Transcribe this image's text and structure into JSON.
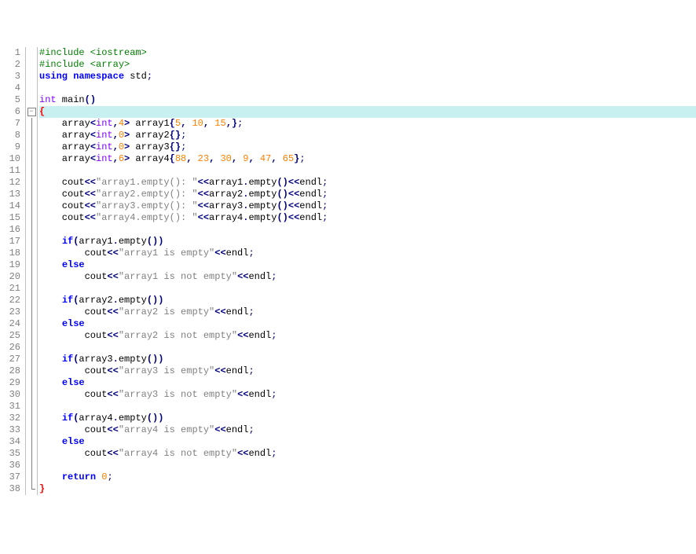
{
  "lines": [
    {
      "n": 1,
      "fold": "",
      "hl": false,
      "tokens": [
        [
          "pre",
          "#include <iostream>"
        ]
      ]
    },
    {
      "n": 2,
      "fold": "",
      "hl": false,
      "tokens": [
        [
          "pre",
          "#include <array>"
        ]
      ]
    },
    {
      "n": 3,
      "fold": "",
      "hl": false,
      "tokens": [
        [
          "kw",
          "using namespace"
        ],
        [
          "",
          " std"
        ],
        [
          "pn",
          ";"
        ]
      ]
    },
    {
      "n": 4,
      "fold": "",
      "hl": false,
      "tokens": [
        [
          "",
          ""
        ]
      ]
    },
    {
      "n": 5,
      "fold": "",
      "hl": false,
      "tokens": [
        [
          "kw2",
          "int"
        ],
        [
          "",
          " main"
        ],
        [
          "op",
          "()"
        ]
      ]
    },
    {
      "n": 6,
      "fold": "box",
      "hl": true,
      "tokens": [
        [
          "brace-r",
          "{"
        ]
      ]
    },
    {
      "n": 7,
      "fold": "vert",
      "hl": false,
      "tokens": [
        [
          "",
          "    array"
        ],
        [
          "op",
          "<"
        ],
        [
          "kw2",
          "int"
        ],
        [
          "op",
          ","
        ],
        [
          "num",
          "4"
        ],
        [
          "op",
          ">"
        ],
        [
          "",
          " array1"
        ],
        [
          "op",
          "{"
        ],
        [
          "num",
          "5"
        ],
        [
          "op",
          ", "
        ],
        [
          "num",
          "10"
        ],
        [
          "op",
          ", "
        ],
        [
          "num",
          "15"
        ],
        [
          "op",
          ",}"
        ],
        [
          "pn",
          ";"
        ]
      ]
    },
    {
      "n": 8,
      "fold": "vert",
      "hl": false,
      "tokens": [
        [
          "",
          "    array"
        ],
        [
          "op",
          "<"
        ],
        [
          "kw2",
          "int"
        ],
        [
          "op",
          ","
        ],
        [
          "num",
          "0"
        ],
        [
          "op",
          ">"
        ],
        [
          "",
          " array2"
        ],
        [
          "op",
          "{}"
        ],
        [
          "pn",
          ";"
        ]
      ]
    },
    {
      "n": 9,
      "fold": "vert",
      "hl": false,
      "tokens": [
        [
          "",
          "    array"
        ],
        [
          "op",
          "<"
        ],
        [
          "kw2",
          "int"
        ],
        [
          "op",
          ","
        ],
        [
          "num",
          "0"
        ],
        [
          "op",
          ">"
        ],
        [
          "",
          " array3"
        ],
        [
          "op",
          "{}"
        ],
        [
          "pn",
          ";"
        ]
      ]
    },
    {
      "n": 10,
      "fold": "vert",
      "hl": false,
      "tokens": [
        [
          "",
          "    array"
        ],
        [
          "op",
          "<"
        ],
        [
          "kw2",
          "int"
        ],
        [
          "op",
          ","
        ],
        [
          "num",
          "6"
        ],
        [
          "op",
          ">"
        ],
        [
          "",
          " array4"
        ],
        [
          "op",
          "{"
        ],
        [
          "num",
          "88"
        ],
        [
          "op",
          ", "
        ],
        [
          "num",
          "23"
        ],
        [
          "op",
          ", "
        ],
        [
          "num",
          "30"
        ],
        [
          "op",
          ", "
        ],
        [
          "num",
          "9"
        ],
        [
          "op",
          ", "
        ],
        [
          "num",
          "47"
        ],
        [
          "op",
          ", "
        ],
        [
          "num",
          "65"
        ],
        [
          "op",
          "}"
        ],
        [
          "pn",
          ";"
        ]
      ]
    },
    {
      "n": 11,
      "fold": "vert",
      "hl": false,
      "tokens": [
        [
          "",
          ""
        ]
      ]
    },
    {
      "n": 12,
      "fold": "vert",
      "hl": false,
      "tokens": [
        [
          "",
          "    cout"
        ],
        [
          "op",
          "<<"
        ],
        [
          "str",
          "\"array1.empty(): \""
        ],
        [
          "op",
          "<<"
        ],
        [
          "",
          "array1"
        ],
        [
          "op",
          "."
        ],
        [
          "",
          "empty"
        ],
        [
          "op",
          "()<<"
        ],
        [
          "",
          "endl"
        ],
        [
          "pn",
          ";"
        ]
      ]
    },
    {
      "n": 13,
      "fold": "vert",
      "hl": false,
      "tokens": [
        [
          "",
          "    cout"
        ],
        [
          "op",
          "<<"
        ],
        [
          "str",
          "\"array2.empty(): \""
        ],
        [
          "op",
          "<<"
        ],
        [
          "",
          "array2"
        ],
        [
          "op",
          "."
        ],
        [
          "",
          "empty"
        ],
        [
          "op",
          "()<<"
        ],
        [
          "",
          "endl"
        ],
        [
          "pn",
          ";"
        ]
      ]
    },
    {
      "n": 14,
      "fold": "vert",
      "hl": false,
      "tokens": [
        [
          "",
          "    cout"
        ],
        [
          "op",
          "<<"
        ],
        [
          "str",
          "\"array3.empty(): \""
        ],
        [
          "op",
          "<<"
        ],
        [
          "",
          "array3"
        ],
        [
          "op",
          "."
        ],
        [
          "",
          "empty"
        ],
        [
          "op",
          "()<<"
        ],
        [
          "",
          "endl"
        ],
        [
          "pn",
          ";"
        ]
      ]
    },
    {
      "n": 15,
      "fold": "vert",
      "hl": false,
      "tokens": [
        [
          "",
          "    cout"
        ],
        [
          "op",
          "<<"
        ],
        [
          "str",
          "\"array4.empty(): \""
        ],
        [
          "op",
          "<<"
        ],
        [
          "",
          "array4"
        ],
        [
          "op",
          "."
        ],
        [
          "",
          "empty"
        ],
        [
          "op",
          "()<<"
        ],
        [
          "",
          "endl"
        ],
        [
          "pn",
          ";"
        ]
      ]
    },
    {
      "n": 16,
      "fold": "vert",
      "hl": false,
      "tokens": [
        [
          "",
          ""
        ]
      ]
    },
    {
      "n": 17,
      "fold": "vert",
      "hl": false,
      "tokens": [
        [
          "",
          "    "
        ],
        [
          "kw",
          "if"
        ],
        [
          "op",
          "("
        ],
        [
          "",
          "array1"
        ],
        [
          "op",
          "."
        ],
        [
          "",
          "empty"
        ],
        [
          "op",
          "())"
        ]
      ]
    },
    {
      "n": 18,
      "fold": "vert",
      "hl": false,
      "tokens": [
        [
          "",
          "        cout"
        ],
        [
          "op",
          "<<"
        ],
        [
          "str",
          "\"array1 is empty\""
        ],
        [
          "op",
          "<<"
        ],
        [
          "",
          "endl"
        ],
        [
          "pn",
          ";"
        ]
      ]
    },
    {
      "n": 19,
      "fold": "vert",
      "hl": false,
      "tokens": [
        [
          "",
          "    "
        ],
        [
          "kw",
          "else"
        ]
      ]
    },
    {
      "n": 20,
      "fold": "vert",
      "hl": false,
      "tokens": [
        [
          "",
          "        cout"
        ],
        [
          "op",
          "<<"
        ],
        [
          "str",
          "\"array1 is not empty\""
        ],
        [
          "op",
          "<<"
        ],
        [
          "",
          "endl"
        ],
        [
          "pn",
          ";"
        ]
      ]
    },
    {
      "n": 21,
      "fold": "vert",
      "hl": false,
      "tokens": [
        [
          "",
          ""
        ]
      ]
    },
    {
      "n": 22,
      "fold": "vert",
      "hl": false,
      "tokens": [
        [
          "",
          "    "
        ],
        [
          "kw",
          "if"
        ],
        [
          "op",
          "("
        ],
        [
          "",
          "array2"
        ],
        [
          "op",
          "."
        ],
        [
          "",
          "empty"
        ],
        [
          "op",
          "())"
        ]
      ]
    },
    {
      "n": 23,
      "fold": "vert",
      "hl": false,
      "tokens": [
        [
          "",
          "        cout"
        ],
        [
          "op",
          "<<"
        ],
        [
          "str",
          "\"array2 is empty\""
        ],
        [
          "op",
          "<<"
        ],
        [
          "",
          "endl"
        ],
        [
          "pn",
          ";"
        ]
      ]
    },
    {
      "n": 24,
      "fold": "vert",
      "hl": false,
      "tokens": [
        [
          "",
          "    "
        ],
        [
          "kw",
          "else"
        ]
      ]
    },
    {
      "n": 25,
      "fold": "vert",
      "hl": false,
      "tokens": [
        [
          "",
          "        cout"
        ],
        [
          "op",
          "<<"
        ],
        [
          "str",
          "\"array2 is not empty\""
        ],
        [
          "op",
          "<<"
        ],
        [
          "",
          "endl"
        ],
        [
          "pn",
          ";"
        ]
      ]
    },
    {
      "n": 26,
      "fold": "vert",
      "hl": false,
      "tokens": [
        [
          "",
          ""
        ]
      ]
    },
    {
      "n": 27,
      "fold": "vert",
      "hl": false,
      "tokens": [
        [
          "",
          "    "
        ],
        [
          "kw",
          "if"
        ],
        [
          "op",
          "("
        ],
        [
          "",
          "array3"
        ],
        [
          "op",
          "."
        ],
        [
          "",
          "empty"
        ],
        [
          "op",
          "())"
        ]
      ]
    },
    {
      "n": 28,
      "fold": "vert",
      "hl": false,
      "tokens": [
        [
          "",
          "        cout"
        ],
        [
          "op",
          "<<"
        ],
        [
          "str",
          "\"array3 is empty\""
        ],
        [
          "op",
          "<<"
        ],
        [
          "",
          "endl"
        ],
        [
          "pn",
          ";"
        ]
      ]
    },
    {
      "n": 29,
      "fold": "vert",
      "hl": false,
      "tokens": [
        [
          "",
          "    "
        ],
        [
          "kw",
          "else"
        ]
      ]
    },
    {
      "n": 30,
      "fold": "vert",
      "hl": false,
      "tokens": [
        [
          "",
          "        cout"
        ],
        [
          "op",
          "<<"
        ],
        [
          "str",
          "\"array3 is not empty\""
        ],
        [
          "op",
          "<<"
        ],
        [
          "",
          "endl"
        ],
        [
          "pn",
          ";"
        ]
      ]
    },
    {
      "n": 31,
      "fold": "vert",
      "hl": false,
      "tokens": [
        [
          "",
          ""
        ]
      ]
    },
    {
      "n": 32,
      "fold": "vert",
      "hl": false,
      "tokens": [
        [
          "",
          "    "
        ],
        [
          "kw",
          "if"
        ],
        [
          "op",
          "("
        ],
        [
          "",
          "array4"
        ],
        [
          "op",
          "."
        ],
        [
          "",
          "empty"
        ],
        [
          "op",
          "())"
        ]
      ]
    },
    {
      "n": 33,
      "fold": "vert",
      "hl": false,
      "tokens": [
        [
          "",
          "        cout"
        ],
        [
          "op",
          "<<"
        ],
        [
          "str",
          "\"array4 is empty\""
        ],
        [
          "op",
          "<<"
        ],
        [
          "",
          "endl"
        ],
        [
          "pn",
          ";"
        ]
      ]
    },
    {
      "n": 34,
      "fold": "vert",
      "hl": false,
      "tokens": [
        [
          "",
          "    "
        ],
        [
          "kw",
          "else"
        ]
      ]
    },
    {
      "n": 35,
      "fold": "vert",
      "hl": false,
      "tokens": [
        [
          "",
          "        cout"
        ],
        [
          "op",
          "<<"
        ],
        [
          "str",
          "\"array4 is not empty\""
        ],
        [
          "op",
          "<<"
        ],
        [
          "",
          "endl"
        ],
        [
          "pn",
          ";"
        ]
      ]
    },
    {
      "n": 36,
      "fold": "vert",
      "hl": false,
      "tokens": [
        [
          "",
          ""
        ]
      ]
    },
    {
      "n": 37,
      "fold": "vert",
      "hl": false,
      "tokens": [
        [
          "",
          "    "
        ],
        [
          "kw",
          "return"
        ],
        [
          "",
          " "
        ],
        [
          "num",
          "0"
        ],
        [
          "pn",
          ";"
        ]
      ]
    },
    {
      "n": 38,
      "fold": "end",
      "hl": false,
      "tokens": [
        [
          "brace-r",
          "}"
        ]
      ]
    }
  ]
}
